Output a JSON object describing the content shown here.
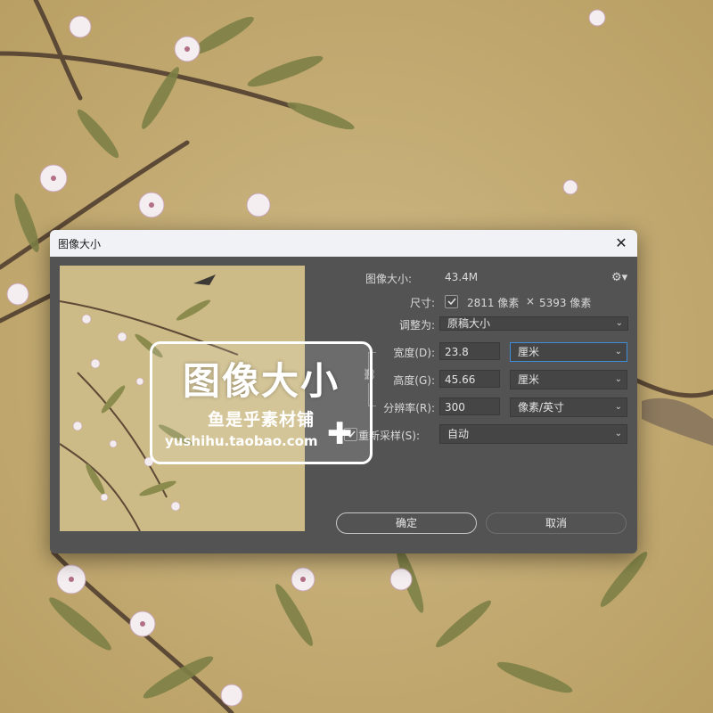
{
  "dialog": {
    "title": "图像大小",
    "close_glyph": "✕",
    "info": {
      "image_size_label": "图像大小:",
      "image_size_value": "43.4M",
      "dimensions_label": "尺寸:",
      "dimensions_width": "2811 像素",
      "dimensions_sep": "×",
      "dimensions_height": "5393 像素"
    },
    "fit_to": {
      "label": "调整为:",
      "value": "原稿大小"
    },
    "width": {
      "label": "宽度(D):",
      "value": "23.8",
      "unit": "厘米"
    },
    "height": {
      "label": "高度(G):",
      "value": "45.66",
      "unit": "厘米"
    },
    "resolution": {
      "label": "分辨率(R):",
      "value": "300",
      "unit": "像素/英寸"
    },
    "resample": {
      "label": "重新采样(S):",
      "checked": true,
      "value": "自动"
    },
    "buttons": {
      "ok": "确定",
      "cancel": "取消"
    }
  },
  "watermark": {
    "title": "图像大小",
    "shop": "鱼是乎素材铺",
    "url": "yushihu.taobao.com",
    "plus": "✚"
  },
  "icons": {
    "gear": "gear-icon",
    "chain": "chain-link-icon",
    "chevron": "chevron-down-icon",
    "check": "checkmark-icon"
  },
  "colors": {
    "dialog_bg": "#535353",
    "titlebar_bg": "#f1f2f5",
    "field_bg": "#454545",
    "accent_focus": "#3f8cd8",
    "background_paper": "#c7b07a"
  }
}
